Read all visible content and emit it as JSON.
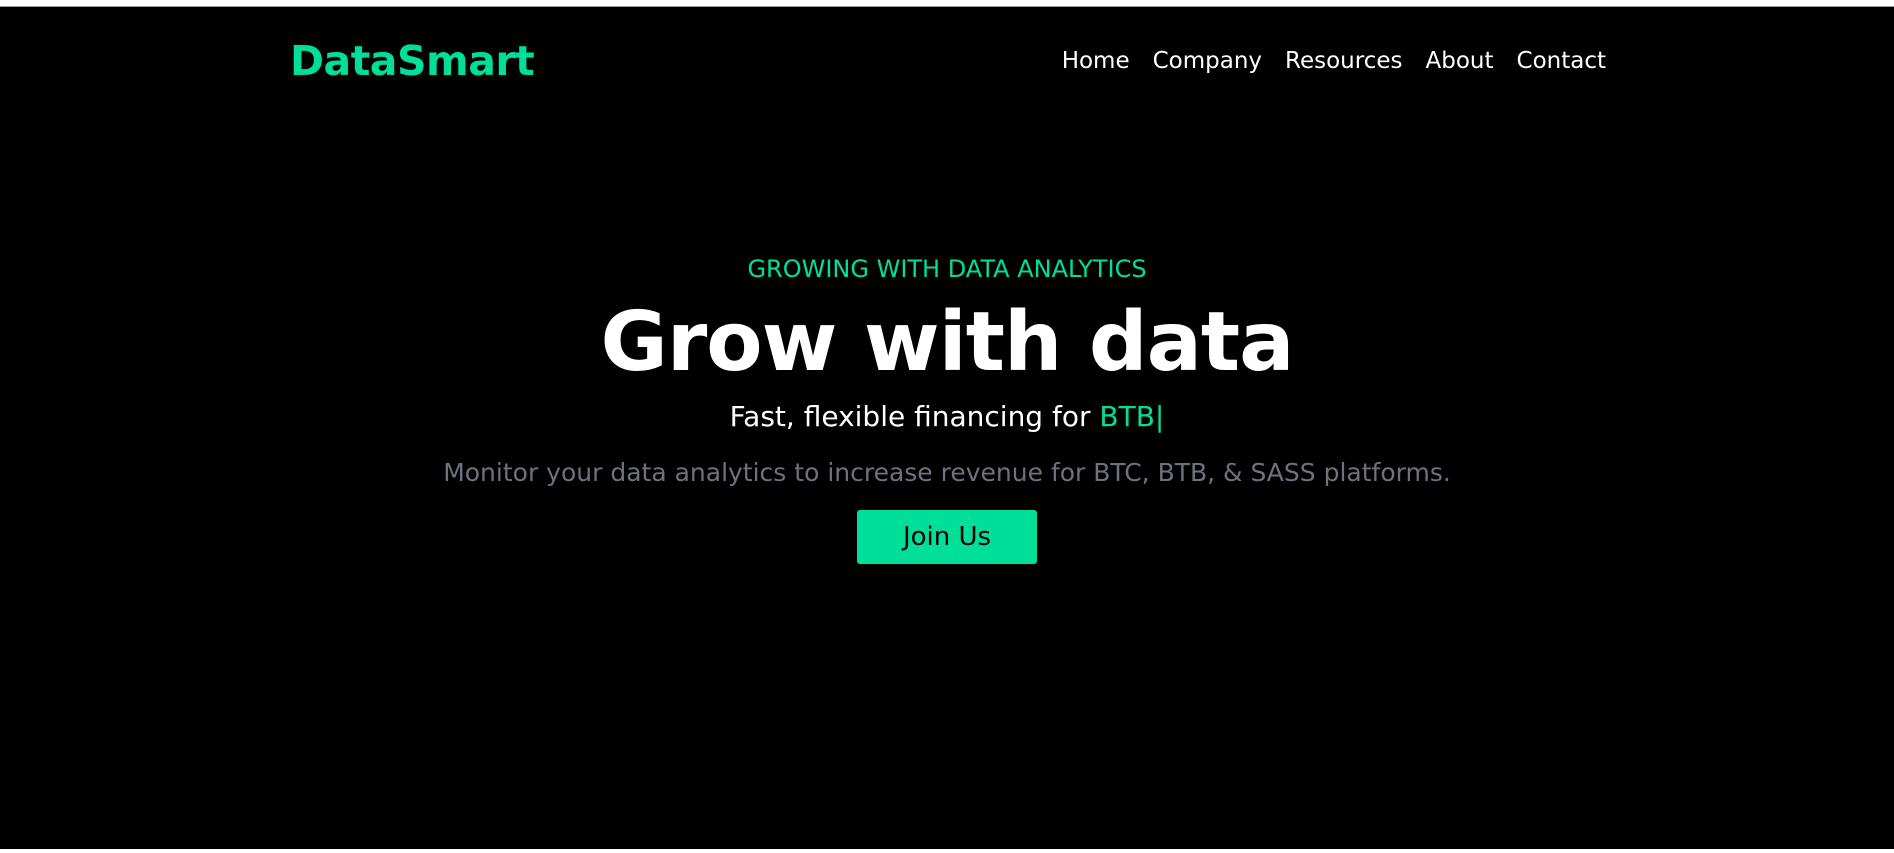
{
  "brand": {
    "name": "DataSmart",
    "accent_color": "#00df9a",
    "background_color": "#000000"
  },
  "nav": {
    "items": [
      {
        "label": "Home"
      },
      {
        "label": "Company"
      },
      {
        "label": "Resources"
      },
      {
        "label": "About"
      },
      {
        "label": "Contact"
      }
    ]
  },
  "hero": {
    "eyebrow": "GROWING WITH DATA ANALYTICS",
    "headline": "Grow with data",
    "subline_prefix": "Fast, flexible financing for",
    "subline_typed": "BTB|",
    "description": "Monitor your data analytics to increase revenue for BTC, BTB, & SASS platforms.",
    "description_color": "#6b7280",
    "cta_label": "Join Us"
  }
}
